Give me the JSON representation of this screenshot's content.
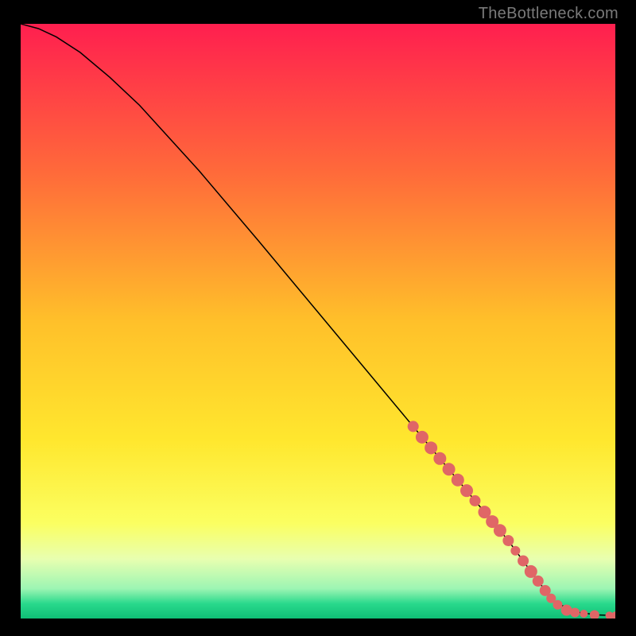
{
  "watermark": "TheBottleneck.com",
  "chart_data": {
    "type": "line",
    "title": "",
    "xlabel": "",
    "ylabel": "",
    "xlim": [
      0,
      100
    ],
    "ylim": [
      0,
      100
    ],
    "grid": false,
    "background_gradient": {
      "stops": [
        {
          "offset": 0.0,
          "color": "#ff1f4f"
        },
        {
          "offset": 0.25,
          "color": "#ff6a3a"
        },
        {
          "offset": 0.5,
          "color": "#ffc02a"
        },
        {
          "offset": 0.7,
          "color": "#ffe72e"
        },
        {
          "offset": 0.84,
          "color": "#fbff61"
        },
        {
          "offset": 0.9,
          "color": "#e8ffb0"
        },
        {
          "offset": 0.95,
          "color": "#9cf5b3"
        },
        {
          "offset": 0.975,
          "color": "#29d98c"
        },
        {
          "offset": 1.0,
          "color": "#0fbf76"
        }
      ]
    },
    "series": [
      {
        "name": "curve",
        "type": "line",
        "color": "#000000",
        "stroke_width": 1.5,
        "x": [
          0,
          3,
          6,
          10,
          15,
          20,
          30,
          40,
          50,
          60,
          70,
          78,
          82,
          85,
          88,
          90,
          94,
          97,
          100
        ],
        "y": [
          100,
          99.2,
          97.8,
          95.2,
          91.0,
          86.3,
          75.3,
          63.5,
          51.5,
          39.5,
          27.5,
          17.9,
          13.1,
          9.0,
          5.0,
          2.6,
          1.0,
          0.6,
          0.5
        ]
      },
      {
        "name": "markers",
        "type": "scatter",
        "color": "#e06666",
        "radius_base": 7,
        "points": [
          {
            "x": 66.0,
            "y": 32.3,
            "r": 7
          },
          {
            "x": 67.5,
            "y": 30.5,
            "r": 8
          },
          {
            "x": 69.0,
            "y": 28.7,
            "r": 8
          },
          {
            "x": 70.5,
            "y": 26.9,
            "r": 8
          },
          {
            "x": 72.0,
            "y": 25.1,
            "r": 8
          },
          {
            "x": 73.5,
            "y": 23.3,
            "r": 8
          },
          {
            "x": 75.0,
            "y": 21.5,
            "r": 8
          },
          {
            "x": 76.4,
            "y": 19.8,
            "r": 7
          },
          {
            "x": 78.0,
            "y": 17.9,
            "r": 8
          },
          {
            "x": 79.3,
            "y": 16.3,
            "r": 8
          },
          {
            "x": 80.6,
            "y": 14.8,
            "r": 8
          },
          {
            "x": 82.0,
            "y": 13.1,
            "r": 7
          },
          {
            "x": 83.2,
            "y": 11.4,
            "r": 6
          },
          {
            "x": 84.5,
            "y": 9.7,
            "r": 7
          },
          {
            "x": 85.8,
            "y": 7.9,
            "r": 8
          },
          {
            "x": 87.0,
            "y": 6.3,
            "r": 7
          },
          {
            "x": 88.2,
            "y": 4.7,
            "r": 7
          },
          {
            "x": 89.2,
            "y": 3.4,
            "r": 6
          },
          {
            "x": 90.3,
            "y": 2.3,
            "r": 6
          },
          {
            "x": 91.8,
            "y": 1.4,
            "r": 7
          },
          {
            "x": 93.2,
            "y": 1.0,
            "r": 6
          },
          {
            "x": 94.7,
            "y": 0.8,
            "r": 5
          },
          {
            "x": 96.5,
            "y": 0.6,
            "r": 6
          },
          {
            "x": 99.0,
            "y": 0.5,
            "r": 5
          },
          {
            "x": 100.0,
            "y": 0.5,
            "r": 5
          }
        ]
      }
    ]
  }
}
